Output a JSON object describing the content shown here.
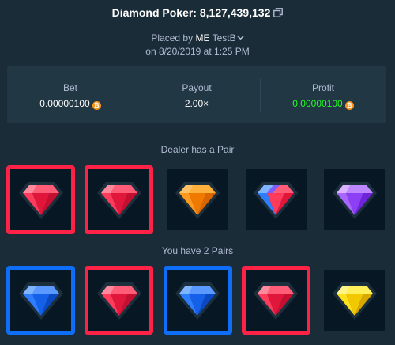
{
  "header": {
    "title": "Diamond Poker: 8,127,439,132",
    "placed_prefix": "Placed by",
    "user": "ME",
    "username": "TestB",
    "date_line": "on 8/20/2019 at 1:25 PM"
  },
  "stats": {
    "bet_label": "Bet",
    "bet_value": "0.00000100",
    "payout_label": "Payout",
    "payout_value": "2.00×",
    "profit_label": "Profit",
    "profit_value": "0.00000100",
    "coin_symbol": "₿",
    "profit_color": "#1fff20"
  },
  "dealer": {
    "label": "Dealer has a Pair",
    "cards": [
      {
        "gem": "red",
        "highlight": "red"
      },
      {
        "gem": "red",
        "highlight": "red"
      },
      {
        "gem": "orange",
        "highlight": "none"
      },
      {
        "gem": "blue-red",
        "highlight": "none"
      },
      {
        "gem": "purple",
        "highlight": "none"
      }
    ]
  },
  "player": {
    "label": "You have 2 Pairs",
    "cards": [
      {
        "gem": "blue",
        "highlight": "blue"
      },
      {
        "gem": "red",
        "highlight": "red"
      },
      {
        "gem": "blue",
        "highlight": "blue"
      },
      {
        "gem": "red",
        "highlight": "red"
      },
      {
        "gem": "yellow",
        "highlight": "none"
      }
    ]
  },
  "colors": {
    "background": "#1a2c38",
    "panel": "#213743",
    "highlight_red": "#fe2247",
    "highlight_blue": "#0f6ef7"
  },
  "icons": {
    "copy": "copy-icon",
    "chevron": "chevron-down-icon",
    "coin": "bitcoin-icon",
    "gem": "diamond-gem-icon"
  }
}
